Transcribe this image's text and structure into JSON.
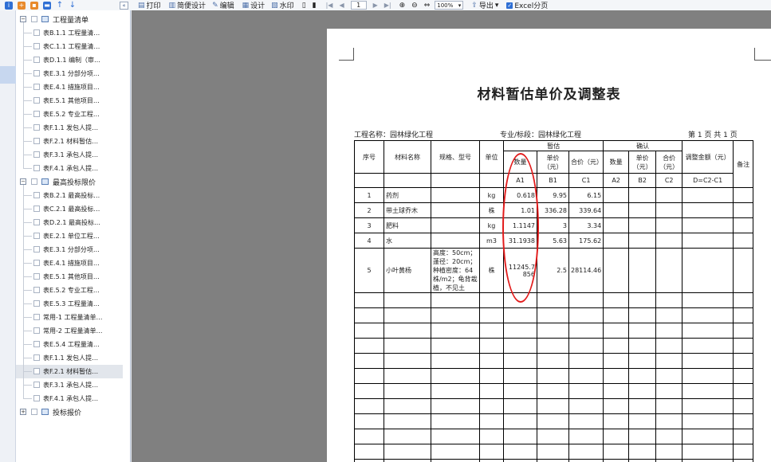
{
  "toolbar": {
    "print": "打印",
    "quick_design": "简便设计",
    "edit": "编辑",
    "design": "设计",
    "watermark": "水印",
    "page_value": "1",
    "zoom_value": "100%",
    "export": "导出",
    "excel_paging": "Excel分页",
    "excel_paging_checked": true
  },
  "tree": {
    "groups": [
      {
        "label": "工程量清单",
        "expanded": true,
        "items": [
          "表B.1.1 工程量清…",
          "表C.1.1 工程量清…",
          "表D.1.1 编制（审…",
          "表E.3.1 分部分项…",
          "表E.4.1 措施项目…",
          "表E.5.1 其他项目…",
          "表E.5.2 专业工程…",
          "表F.1.1 发包人提…",
          "表F.2.1 材料暂估…",
          "表F.3.1 承包人提…",
          "表F.4.1 承包人提…"
        ]
      },
      {
        "label": "最高投标限价",
        "expanded": true,
        "items": [
          "表B.2.1 最高投标…",
          "表C.2.1 最高投标…",
          "表D.2.1 最高投标…",
          "表E.2.1 单位工程…",
          "表E.3.1 分部分项…",
          "表E.4.1 措施项目…",
          "表E.5.1 其他项目…",
          "表E.5.2 专业工程…",
          "表E.5.3 工程量清…",
          "常用-1 工程量清单…",
          "常用-2 工程量清单…",
          "表E.5.4 工程量清…",
          "表F.1.1 发包人提…",
          "表F.2.1 材料暂估…",
          "表F.3.1 承包人提…",
          "表F.4.1 承包人提…"
        ],
        "selected_index": 13
      },
      {
        "label": "投标报价",
        "expanded": false,
        "items": []
      }
    ]
  },
  "report": {
    "title": "材料暂估单价及调整表",
    "project_label": "工程名称：园林绿化工程",
    "section_label": "专业/标段：园林绿化工程",
    "page_label": "第 1 页  共 1 页",
    "headers": {
      "seq": "序号",
      "name": "材料名称",
      "spec": "规格、型号",
      "unit": "单位",
      "estimate": "暂估",
      "confirm": "确认",
      "adjust": "调整金额（元）",
      "remark": "备注",
      "qty": "数量",
      "price": "单价（元）",
      "total": "合价（元）",
      "confirm_qty": "数量",
      "confirm_price": "单价（元）",
      "confirm_total": "合价（元）",
      "code_a1": "A1",
      "code_b1": "B1",
      "code_c1": "C1",
      "code_a2": "A2",
      "code_b2": "B2",
      "code_c2": "C2",
      "code_d": "D=C2-C1"
    },
    "rows": [
      {
        "seq": "1",
        "name": "药剂",
        "spec": "",
        "unit": "kg",
        "qty": "0.618",
        "price": "9.95",
        "total": "6.15"
      },
      {
        "seq": "2",
        "name": "带土球乔木",
        "spec": "",
        "unit": "株",
        "qty": "1.01",
        "price": "336.28",
        "total": "339.64"
      },
      {
        "seq": "3",
        "name": "肥料",
        "spec": "",
        "unit": "kg",
        "qty": "1.1147",
        "price": "3",
        "total": "3.34"
      },
      {
        "seq": "4",
        "name": "水",
        "spec": "",
        "unit": "m3",
        "qty": "31.1938",
        "price": "5.63",
        "total": "175.62"
      },
      {
        "seq": "5",
        "name": "小叶黄杨",
        "spec": "高度：50cm；蓬径：20cm；种植密度：64株/m2；龟背栽植，不见土",
        "unit": "株",
        "qty": "11245.7856",
        "price": "2.5",
        "total": "28114.46"
      }
    ],
    "empty_rows": 12
  }
}
